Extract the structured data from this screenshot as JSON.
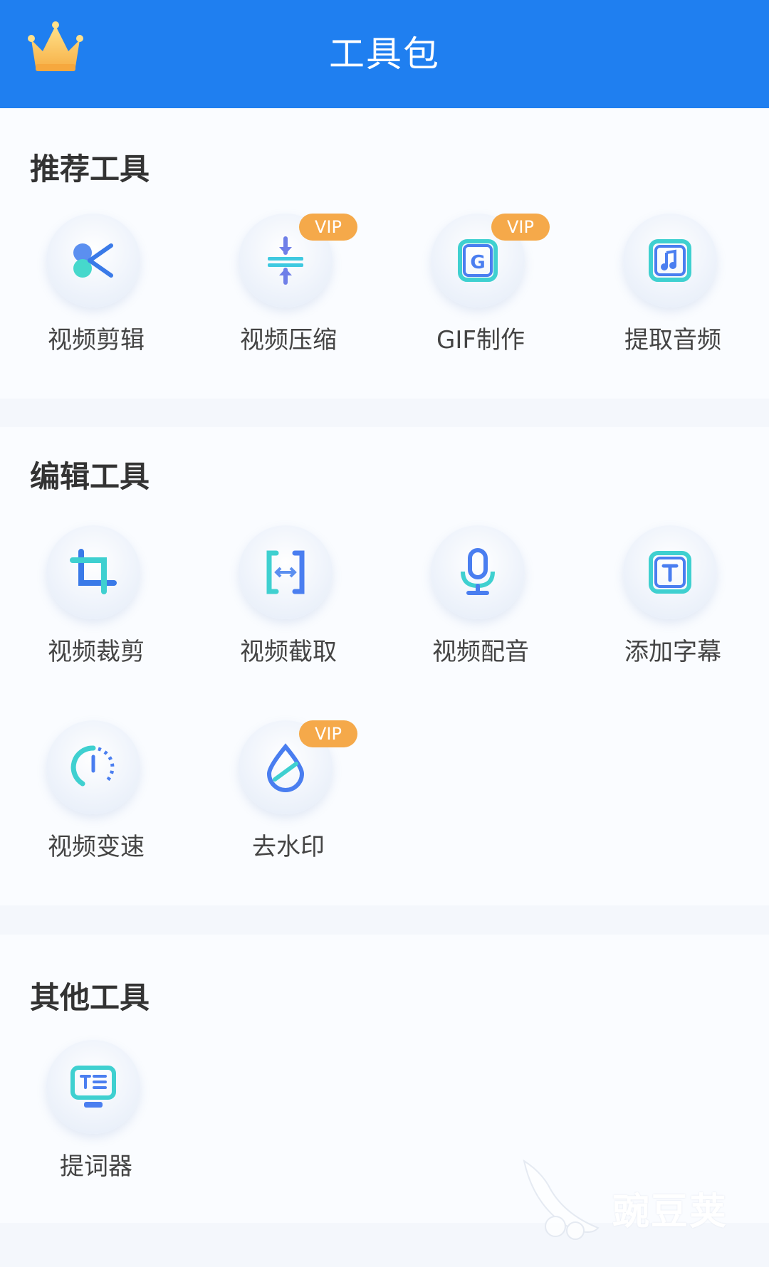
{
  "header": {
    "title": "工具包",
    "crown_icon": "crown-icon"
  },
  "sections": [
    {
      "title": "推荐工具",
      "tools": [
        {
          "label": "视频剪辑",
          "icon": "scissors-icon",
          "vip": ""
        },
        {
          "label": "视频压缩",
          "icon": "compress-icon",
          "vip": "VIP"
        },
        {
          "label": "GIF制作",
          "icon": "gif-icon",
          "vip": "VIP"
        },
        {
          "label": "提取音频",
          "icon": "music-icon",
          "vip": ""
        }
      ]
    },
    {
      "title": "编辑工具",
      "tools": [
        {
          "label": "视频裁剪",
          "icon": "crop-icon",
          "vip": ""
        },
        {
          "label": "视频截取",
          "icon": "trim-icon",
          "vip": ""
        },
        {
          "label": "视频配音",
          "icon": "microphone-icon",
          "vip": ""
        },
        {
          "label": "添加字幕",
          "icon": "subtitle-icon",
          "vip": ""
        },
        {
          "label": "视频变速",
          "icon": "speed-icon",
          "vip": ""
        },
        {
          "label": "去水印",
          "icon": "watermark-drop-icon",
          "vip": "VIP"
        }
      ]
    },
    {
      "title": "其他工具",
      "tools": [
        {
          "label": "提词器",
          "icon": "teleprompter-icon",
          "vip": ""
        }
      ]
    }
  ],
  "watermark": {
    "text": "豌豆荚",
    "icon": "pea-pod-icon"
  },
  "colors": {
    "header": "#1f7ff0",
    "vip": "#f5a94a",
    "icon_blue": "#2f7be8",
    "icon_cyan": "#3fd6d0"
  }
}
